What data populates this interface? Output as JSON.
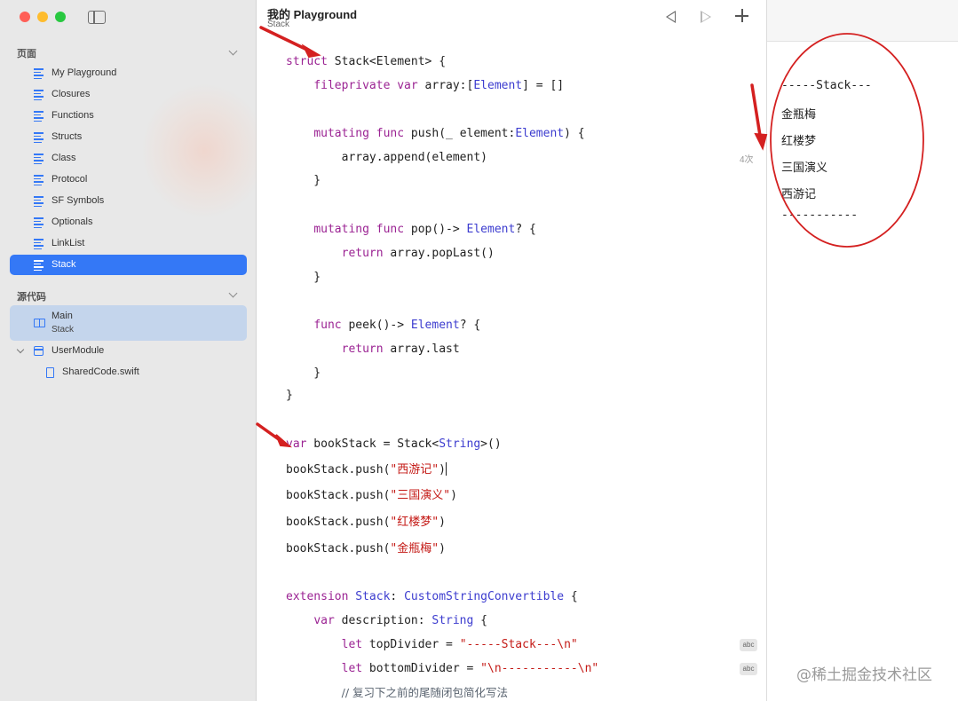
{
  "sidebar": {
    "pages_title": "页面",
    "pages": [
      {
        "label": "My Playground"
      },
      {
        "label": "Closures"
      },
      {
        "label": "Functions"
      },
      {
        "label": "Structs"
      },
      {
        "label": "Class"
      },
      {
        "label": "Protocol"
      },
      {
        "label": "SF Symbols"
      },
      {
        "label": "Optionals"
      },
      {
        "label": "LinkList"
      },
      {
        "label": "Stack",
        "selected": true
      }
    ],
    "source_title": "源代码",
    "main_item": {
      "title": "Main",
      "subtitle": "Stack"
    },
    "module": {
      "label": "UserModule"
    },
    "shared_file": {
      "label": "SharedCode.swift"
    }
  },
  "editor": {
    "title": "我的 Playground",
    "subtitle": "Stack",
    "result_count": "4次",
    "badge": "abc"
  },
  "code": [
    {
      "parts": [
        {
          "t": "struct",
          "c": "kw"
        },
        {
          "t": " Stack<Element> {"
        }
      ]
    },
    {
      "parts": [
        {
          "t": "    "
        },
        {
          "t": "fileprivate",
          "c": "kw"
        },
        {
          "t": " "
        },
        {
          "t": "var",
          "c": "kw"
        },
        {
          "t": " array:["
        },
        {
          "t": "Element",
          "c": "ty"
        },
        {
          "t": "] = []"
        }
      ]
    },
    {
      "parts": [
        {
          "t": "    "
        },
        {
          "t": "mutating",
          "c": "kw"
        },
        {
          "t": " "
        },
        {
          "t": "func",
          "c": "kw"
        },
        {
          "t": " push(_ element:"
        },
        {
          "t": "Element",
          "c": "ty"
        },
        {
          "t": ") {"
        }
      ]
    },
    {
      "parts": [
        {
          "t": "        array.append(element)"
        }
      ]
    },
    {
      "parts": [
        {
          "t": "    }"
        }
      ]
    },
    {
      "parts": [
        {
          "t": "    "
        },
        {
          "t": "mutating",
          "c": "kw"
        },
        {
          "t": " "
        },
        {
          "t": "func",
          "c": "kw"
        },
        {
          "t": " pop()-> "
        },
        {
          "t": "Element",
          "c": "ty"
        },
        {
          "t": "? {"
        }
      ]
    },
    {
      "parts": [
        {
          "t": "        "
        },
        {
          "t": "return",
          "c": "kw"
        },
        {
          "t": " array.popLast()"
        }
      ]
    },
    {
      "parts": [
        {
          "t": "    }"
        }
      ]
    },
    {
      "parts": [
        {
          "t": "    "
        },
        {
          "t": "func",
          "c": "kw"
        },
        {
          "t": " peek()-> "
        },
        {
          "t": "Element",
          "c": "ty"
        },
        {
          "t": "? {"
        }
      ]
    },
    {
      "parts": [
        {
          "t": "        "
        },
        {
          "t": "return",
          "c": "kw"
        },
        {
          "t": " array.last"
        }
      ]
    },
    {
      "parts": [
        {
          "t": "    }"
        }
      ]
    },
    {
      "parts": [
        {
          "t": "}"
        }
      ]
    },
    {
      "parts": [
        {
          "t": "var",
          "c": "kw"
        },
        {
          "t": " bookStack = Stack<"
        },
        {
          "t": "String",
          "c": "ty"
        },
        {
          "t": ">()"
        }
      ]
    },
    {
      "parts": [
        {
          "t": "bookStack.push("
        },
        {
          "t": "\"西游记\"",
          "c": "str"
        },
        {
          "t": ")"
        }
      ],
      "caret": true
    },
    {
      "parts": [
        {
          "t": "bookStack.push("
        },
        {
          "t": "\"三国演义\"",
          "c": "str"
        },
        {
          "t": ")"
        }
      ]
    },
    {
      "parts": [
        {
          "t": "bookStack.push("
        },
        {
          "t": "\"红楼梦\"",
          "c": "str"
        },
        {
          "t": ")"
        }
      ]
    },
    {
      "parts": [
        {
          "t": "bookStack.push("
        },
        {
          "t": "\"金瓶梅\"",
          "c": "str"
        },
        {
          "t": ")"
        }
      ]
    },
    {
      "parts": [
        {
          "t": "extension",
          "c": "kw"
        },
        {
          "t": " "
        },
        {
          "t": "Stack",
          "c": "ty"
        },
        {
          "t": ": "
        },
        {
          "t": "CustomStringConvertible",
          "c": "ty"
        },
        {
          "t": " {"
        }
      ]
    },
    {
      "parts": [
        {
          "t": "    "
        },
        {
          "t": "var",
          "c": "kw"
        },
        {
          "t": " description: "
        },
        {
          "t": "String",
          "c": "ty"
        },
        {
          "t": " {"
        }
      ]
    },
    {
      "parts": [
        {
          "t": "        "
        },
        {
          "t": "let",
          "c": "kw"
        },
        {
          "t": " topDivider = "
        },
        {
          "t": "\"-----Stack---\\n\"",
          "c": "str"
        }
      ]
    },
    {
      "parts": [
        {
          "t": "        "
        },
        {
          "t": "let",
          "c": "kw"
        },
        {
          "t": " bottomDivider = "
        },
        {
          "t": "\"\\n-----------\\n\"",
          "c": "str"
        }
      ]
    },
    {
      "parts": [
        {
          "t": "        "
        },
        {
          "t": "// 复习下之前的尾随闭包简化写法",
          "c": "cm"
        }
      ]
    }
  ],
  "results": [
    {
      "text": "-----Stack---",
      "mono": true
    },
    {
      "text": "金瓶梅"
    },
    {
      "text": "红楼梦"
    },
    {
      "text": "三国演义"
    },
    {
      "text": "西游记"
    },
    {
      "text": "-----------",
      "mono": true
    }
  ],
  "watermark": "@稀土掘金技术社区",
  "annotation_color": "#d42020"
}
